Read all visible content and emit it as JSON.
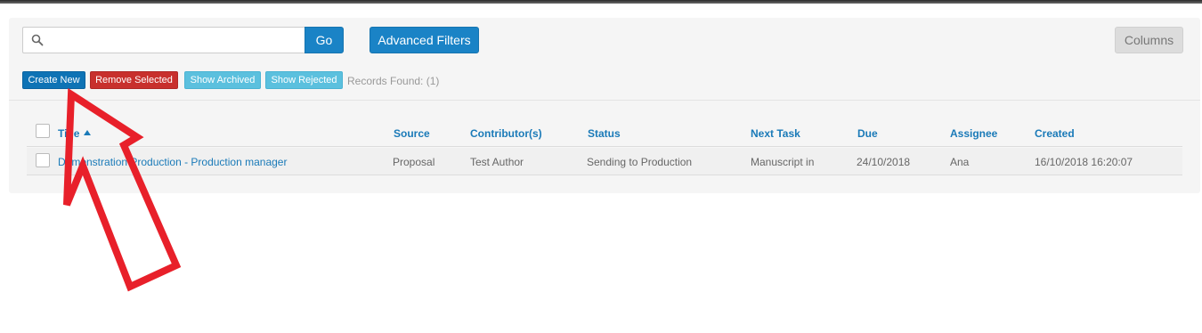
{
  "search": {
    "value": "",
    "placeholder": "",
    "go_label": "Go"
  },
  "toolbar": {
    "advanced_filters_label": "Advanced Filters",
    "columns_label": "Columns",
    "create_new_label": "Create New",
    "remove_selected_label": "Remove Selected",
    "show_archived_label": "Show Archived",
    "show_rejected_label": "Show Rejected",
    "records_found": "Records Found: (1)"
  },
  "table": {
    "columns": [
      "Title",
      "Source",
      "Contributor(s)",
      "Status",
      "Next Task",
      "Due",
      "Assignee",
      "Created"
    ],
    "rows": [
      [
        "Demonstration Production - Production manager",
        "Proposal",
        "Test Author",
        "Sending to Production",
        "Manuscript in",
        "24/10/2018",
        "Ana",
        "16/10/2018 16:20:07"
      ]
    ]
  },
  "colors": {
    "primary": "#1a83c6",
    "danger": "#c8302d",
    "info": "#5bc0de",
    "link": "#1a7ab8",
    "annotation_arrow": "#e8202a"
  },
  "icons": {
    "search": "search-icon",
    "sort": "sort-asc-icon",
    "annotation": "annotation-arrow"
  }
}
